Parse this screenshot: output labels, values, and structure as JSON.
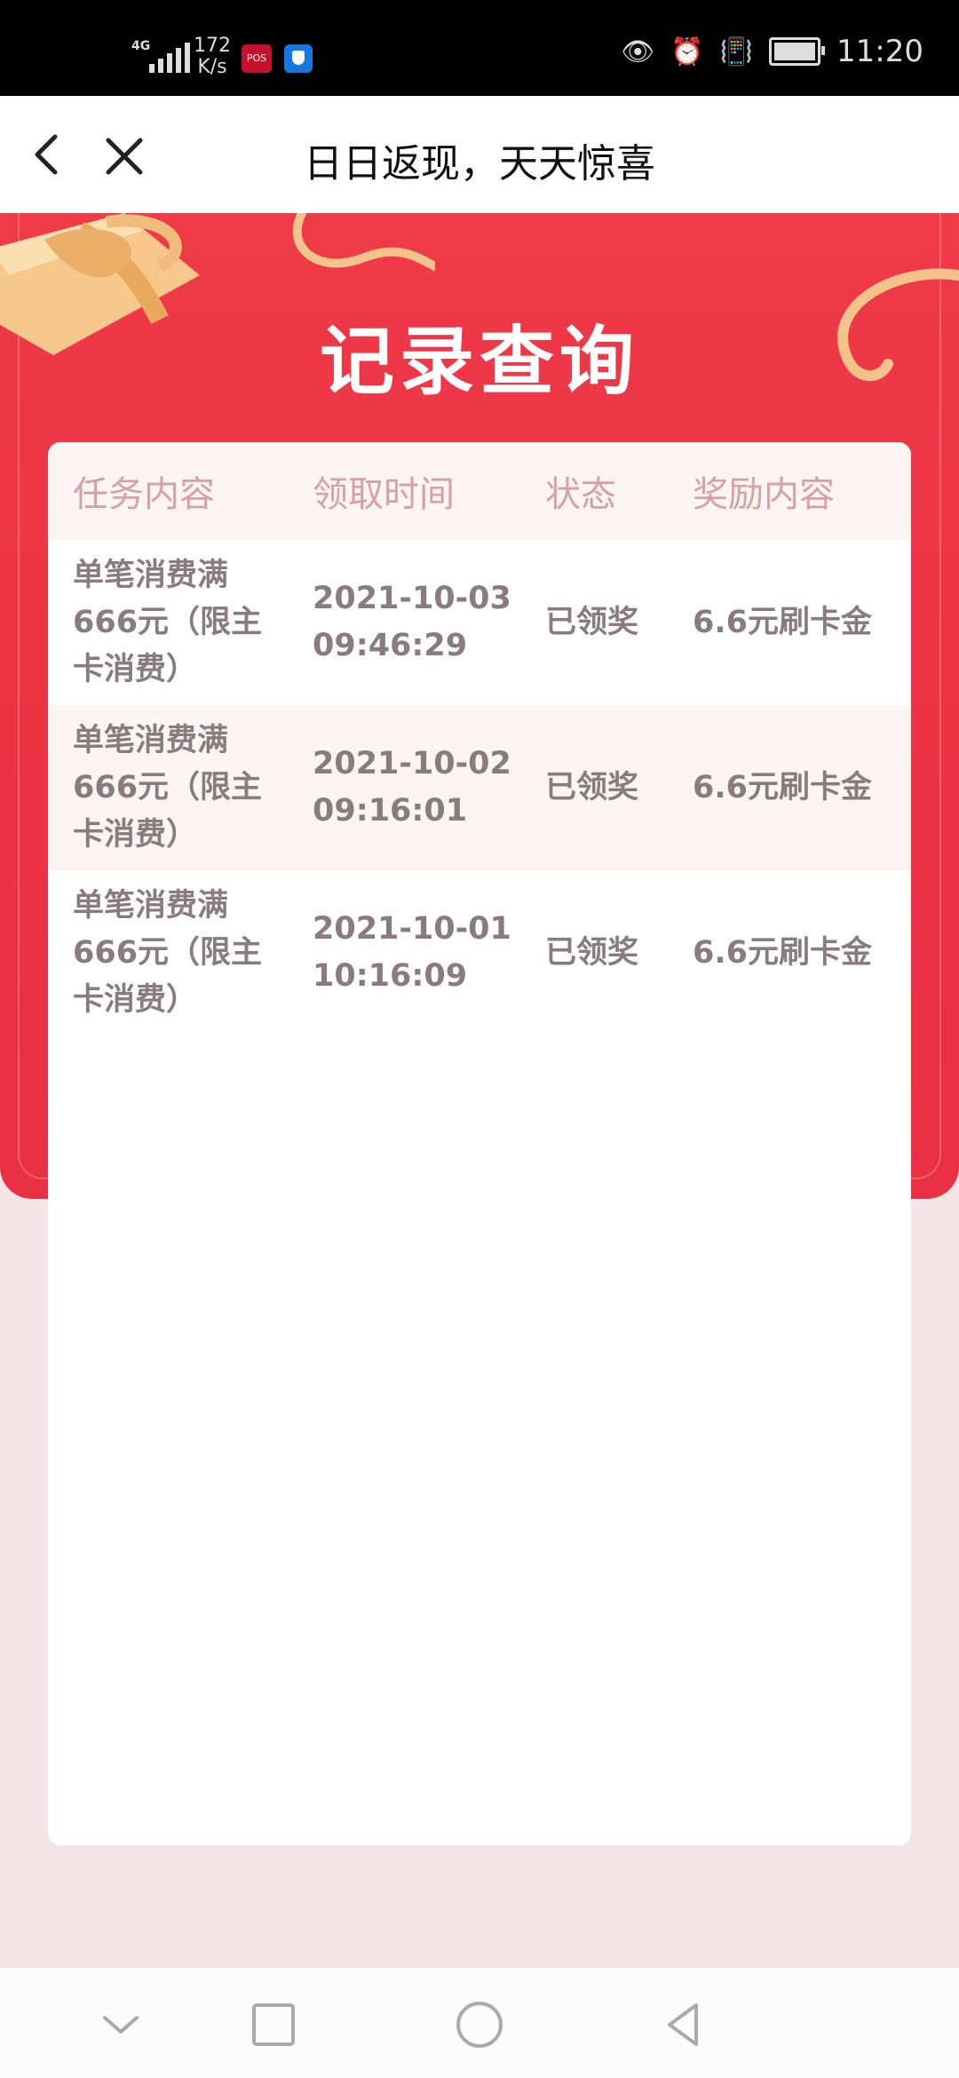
{
  "status_bar": {
    "network": "4G",
    "speed_value": "172",
    "speed_unit": "K/s",
    "app_badge": "POS",
    "time": "11:20"
  },
  "title_bar": {
    "title": "日日返现，天天惊喜"
  },
  "banner": {
    "heading": "记录查询"
  },
  "table": {
    "headers": [
      "任务内容",
      "领取时间",
      "状态",
      "奖励内容"
    ],
    "rows": [
      {
        "task": "单笔消费满666元（限主卡消费）",
        "date": "2021-10-03",
        "time": "09:46:29",
        "status": "已领奖",
        "reward": "6.6元刷卡金"
      },
      {
        "task": "单笔消费满666元（限主卡消费）",
        "date": "2021-10-02",
        "time": "09:16:01",
        "status": "已领奖",
        "reward": "6.6元刷卡金"
      },
      {
        "task": "单笔消费满666元（限主卡消费）",
        "date": "2021-10-01",
        "time": "10:16:09",
        "status": "已领奖",
        "reward": "6.6元刷卡金"
      }
    ]
  },
  "colors": {
    "banner_red": "#ec3244",
    "header_text": "#d9a0a4",
    "cell_text": "#8a7b7d",
    "page_bg": "#f3e4e6"
  },
  "icons": {
    "back": "chevron-left-icon",
    "close": "close-icon",
    "nav_hide": "chevron-down-icon",
    "nav_recent": "square-icon",
    "nav_home": "circle-icon",
    "nav_back": "triangle-left-icon"
  }
}
